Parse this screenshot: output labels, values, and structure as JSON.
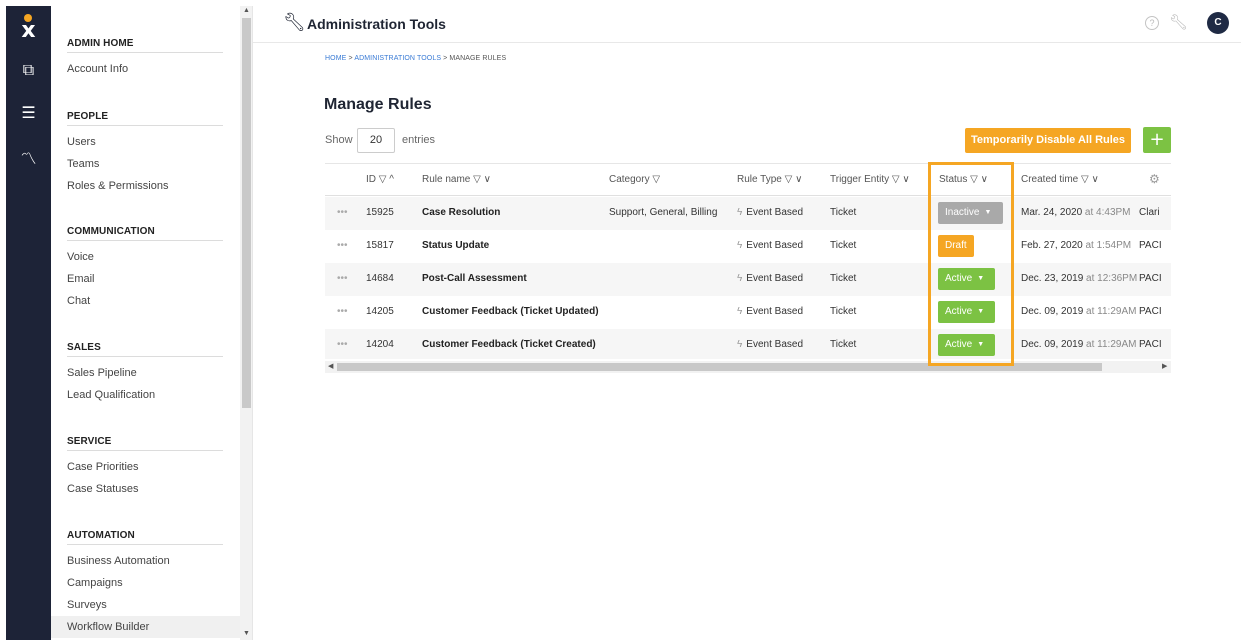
{
  "rail": {
    "logo": "x",
    "icons": [
      "copy-icon",
      "list-icon",
      "graph-icon"
    ]
  },
  "sidebar": {
    "sections": [
      {
        "heading": "ADMIN HOME",
        "items": [
          "Account Info"
        ]
      },
      {
        "heading": "PEOPLE",
        "items": [
          "Users",
          "Teams",
          "Roles & Permissions"
        ]
      },
      {
        "heading": "COMMUNICATION",
        "items": [
          "Voice",
          "Email",
          "Chat"
        ]
      },
      {
        "heading": "SALES",
        "items": [
          "Sales Pipeline",
          "Lead Qualification"
        ]
      },
      {
        "heading": "SERVICE",
        "items": [
          "Case Priorities",
          "Case Statuses"
        ]
      },
      {
        "heading": "AUTOMATION",
        "items": [
          "Business Automation",
          "Campaigns",
          "Surveys",
          "Workflow Builder"
        ]
      }
    ],
    "selected_item": "Workflow Builder"
  },
  "topbar": {
    "title": "Administration Tools",
    "help": "?",
    "avatar": "C"
  },
  "breadcrumb": {
    "home": "HOME",
    "sep1": " > ",
    "admin": "ADMINISTRATION TOOLS",
    "sep2": " > ",
    "current": "MANAGE RULES"
  },
  "page": {
    "title": "Manage Rules",
    "show_label": "Show",
    "entries_value": "20",
    "entries_label": "entries",
    "disable_button": "Temporarily Disable All Rules",
    "add_button": "+"
  },
  "table": {
    "columns": {
      "id": "ID ▽ ^",
      "name": "Rule name ▽ ∨",
      "category": "Category ▽",
      "type": "Rule Type ▽ ∨",
      "trigger": "Trigger Entity ▽ ∨",
      "status": "Status ▽ ∨",
      "created": "Created time ▽ ∨"
    },
    "rows": [
      {
        "dots": "•••",
        "id": "15925",
        "name": "Case Resolution",
        "category": "Support, General, Billing",
        "type": "Event Based",
        "trigger": "Ticket",
        "status": "Inactive",
        "status_kind": "inactive",
        "created_date": "Mar. 24, 2020",
        "created_time": " at 4:43PM",
        "owner": "Clari"
      },
      {
        "dots": "•••",
        "id": "15817",
        "name": "Status Update",
        "category": "",
        "type": "Event Based",
        "trigger": "Ticket",
        "status": "Draft",
        "status_kind": "draft",
        "created_date": "Feb. 27, 2020",
        "created_time": " at 1:54PM",
        "owner": "PACI"
      },
      {
        "dots": "•••",
        "id": "14684",
        "name": "Post-Call Assessment",
        "category": "",
        "type": "Event Based",
        "trigger": "Ticket",
        "status": "Active",
        "status_kind": "active",
        "created_date": "Dec. 23, 2019",
        "created_time": " at 12:36PM",
        "owner": "PACI"
      },
      {
        "dots": "•••",
        "id": "14205",
        "name": "Customer Feedback (Ticket Updated)",
        "category": "",
        "type": "Event Based",
        "trigger": "Ticket",
        "status": "Active",
        "status_kind": "active",
        "created_date": "Dec. 09, 2019",
        "created_time": " at 11:29AM",
        "owner": "PACI"
      },
      {
        "dots": "•••",
        "id": "14204",
        "name": "Customer Feedback (Ticket Created)",
        "category": "",
        "type": "Event Based",
        "trigger": "Ticket",
        "status": "Active",
        "status_kind": "active",
        "created_date": "Dec. 09, 2019",
        "created_time": " at 11:29AM",
        "owner": "PACI"
      }
    ]
  },
  "colors": {
    "rail_bg": "#1d2337",
    "accent_orange": "#f5a623",
    "active_green": "#7cc243",
    "inactive_gray": "#a9a9a9"
  }
}
